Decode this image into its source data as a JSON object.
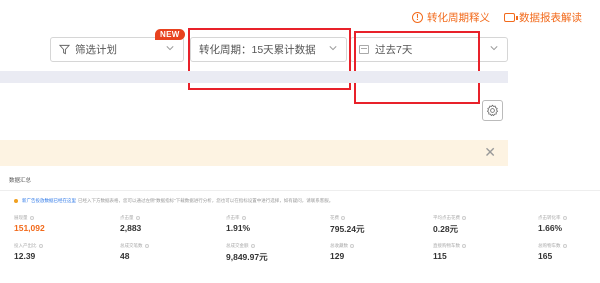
{
  "header": {
    "help_link": "转化周期释义",
    "report_link": "数据报表解读"
  },
  "filters": {
    "plan_label": "筛选计划",
    "new_badge": "NEW",
    "period_label": "转化周期：15天累计数据",
    "range_label": "过去7天"
  },
  "summary": {
    "title": "数据汇总",
    "notice_link": "新广告投放数据已经在这里",
    "notice_text": "已经入下方数据表格，您可以通过左侧\"数据指标\"下载数据进行分析，您也可以在指标设置中进行选择，如有疑问，请联系客服。"
  },
  "metrics": [
    {
      "label": "展现量",
      "value": "151,092"
    },
    {
      "label": "点击量",
      "value": "2,883"
    },
    {
      "label": "点击率",
      "value": "1.91%"
    },
    {
      "label": "花费",
      "value": "795.24元"
    },
    {
      "label": "平均点击花费",
      "value": "0.28元"
    },
    {
      "label": "点击转化率",
      "value": "1.66%"
    },
    {
      "label": "投入产出比",
      "value": "12.39"
    },
    {
      "label": "总成交笔数",
      "value": "48"
    },
    {
      "label": "总成交金额",
      "value": "9,849.97元"
    },
    {
      "label": "总收藏数",
      "value": "129"
    },
    {
      "label": "直接购物车数",
      "value": "115"
    },
    {
      "label": "总购物车数",
      "value": "165"
    }
  ],
  "colors": {
    "accent": "#f26a1b",
    "annotation": "#e8212a",
    "badge": "#e8421f",
    "link": "#2b77e8"
  }
}
